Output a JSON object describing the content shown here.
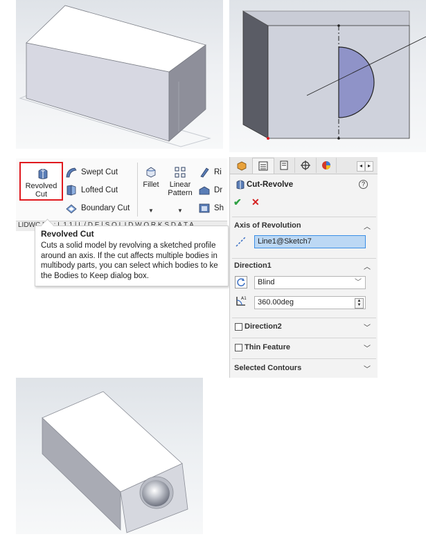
{
  "ribbon": {
    "revolved_cut": "Revolved\nCut",
    "swept_cut": "Swept Cut",
    "lofted_cut": "Lofted Cut",
    "boundary_cut": "Boundary Cut",
    "fillet": "Fillet",
    "linear_pattern": "Linear\nPattern",
    "rib": "Ri",
    "draft": "Dr",
    "shell": "Sh",
    "tabs_text": "LIDWC  5  1  ;  L  1  1  |  L  /  D  E  |  S  O  L  I  D  W  O  R  K  S   D  A  T  A"
  },
  "tooltip": {
    "title": "Revolved Cut",
    "body": "Cuts a solid model by revolving a sketched profile\naround an axis. If the cut affects multiple bodies in\nmultibody parts, you can select which bodies to ke\nthe Bodies to Keep dialog box."
  },
  "property_manager": {
    "title": "Cut-Revolve",
    "help": "?",
    "ok": "✔",
    "cancel": "✕",
    "axis_section": "Axis of Revolution",
    "axis_value": "Line1@Sketch7",
    "direction1_section": "Direction1",
    "end_condition": "Blind",
    "angle": "360.00deg",
    "direction2": "Direction2",
    "thin_feature": "Thin Feature",
    "selected_contours": "Selected Contours"
  },
  "colors": {
    "highlight_red": "#e0191e",
    "profile_fill": "#8f93c8",
    "selection_blue": "#bcd8f4"
  }
}
